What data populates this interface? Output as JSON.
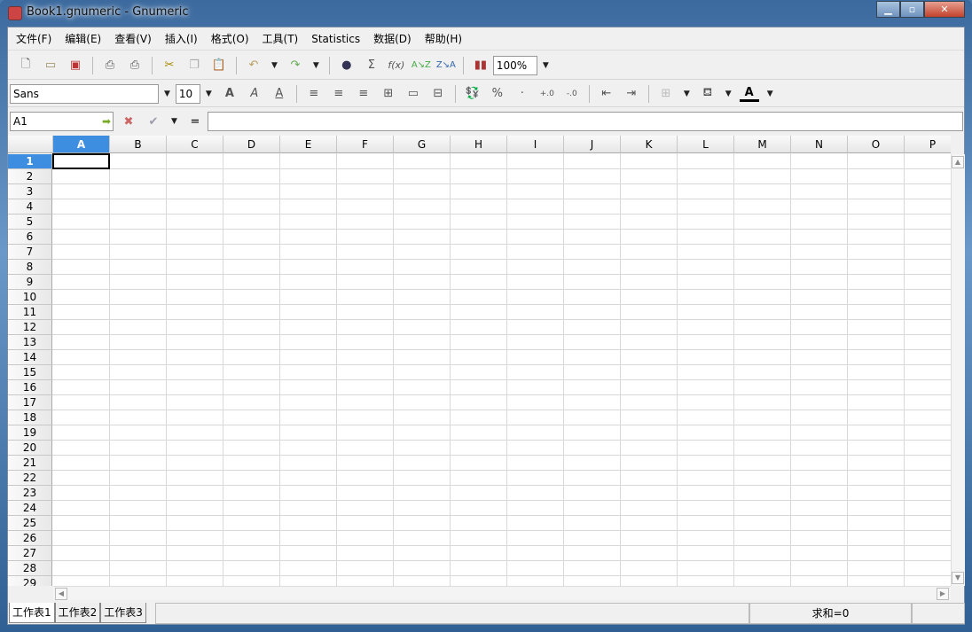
{
  "window": {
    "title": "Book1.gnumeric - Gnumeric"
  },
  "menu": [
    "文件(F)",
    "编辑(E)",
    "查看(V)",
    "插入(I)",
    "格式(O)",
    "工具(T)",
    "Statistics",
    "数据(D)",
    "帮助(H)"
  ],
  "toolbar": {
    "zoom": "100%",
    "font_name": "Sans",
    "font_size": "10"
  },
  "formula_bar": {
    "cell_ref": "A1",
    "equals": "=",
    "value": ""
  },
  "grid": {
    "columns": [
      "A",
      "B",
      "C",
      "D",
      "E",
      "F",
      "G",
      "H",
      "I",
      "J",
      "K",
      "L",
      "M",
      "N",
      "O",
      "P"
    ],
    "rows": [
      "1",
      "2",
      "3",
      "4",
      "5",
      "6",
      "7",
      "8",
      "9",
      "10",
      "11",
      "12",
      "13",
      "14",
      "15",
      "16",
      "17",
      "18",
      "19",
      "20",
      "21",
      "22",
      "23",
      "24",
      "25",
      "26",
      "27",
      "28",
      "29"
    ],
    "selected_cell": "A1",
    "selection_color": "#3d8ee0"
  },
  "sheets": [
    {
      "label": "工作表1",
      "active": true
    },
    {
      "label": "工作表2",
      "active": false
    },
    {
      "label": "工作表3",
      "active": false
    }
  ],
  "status": {
    "sum": "求和=0"
  }
}
